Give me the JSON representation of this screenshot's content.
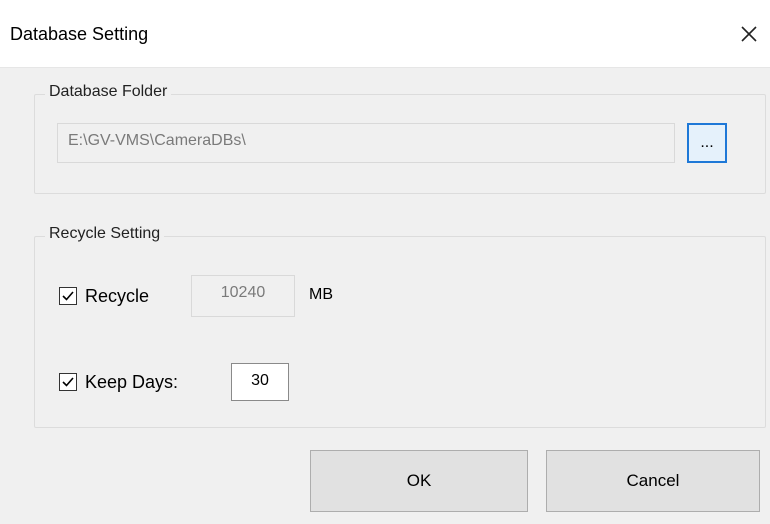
{
  "window": {
    "title": "Database Setting",
    "close_icon": "close-icon"
  },
  "database_folder": {
    "group_title": "Database Folder",
    "path_value": "E:\\GV-VMS\\CameraDBs\\",
    "browse_label": "..."
  },
  "recycle_setting": {
    "group_title": "Recycle Setting",
    "recycle": {
      "checked": true,
      "label": "Recycle",
      "value": "10240",
      "unit": "MB"
    },
    "keep_days": {
      "checked": true,
      "label": "Keep Days:",
      "value": "30"
    }
  },
  "buttons": {
    "ok_label": "OK",
    "cancel_label": "Cancel"
  },
  "colors": {
    "focus_accent": "#1e78d7",
    "dialog_background": "#f0f0f0"
  }
}
